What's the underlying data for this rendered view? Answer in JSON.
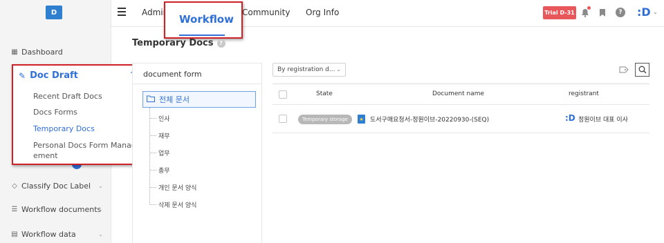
{
  "header": {
    "logo_letter": "D",
    "nav": [
      "Admin",
      "Workflow",
      "Community",
      "Org Info"
    ],
    "trial_badge": "Trial D-31",
    "brand_mark": ":D",
    "highlight_color": "#cf2026",
    "accent_color": "#2f6fd6"
  },
  "sidebar": {
    "dashboard": "Dashboard",
    "doc_draft": {
      "title": "Doc Draft",
      "items": [
        "Recent Draft Docs",
        "Docs Forms",
        "Temporary Docs",
        "Personal Docs Form Manag ement"
      ],
      "active_index": 2
    },
    "classify": "Classify Doc Label",
    "workflow_documents": "Workflow documents",
    "workflow_data": "Workflow data"
  },
  "content": {
    "page_title": "Temporary Docs",
    "tree": {
      "header": "document form",
      "root": "전체 문서",
      "nodes": [
        "인사",
        "재무",
        "업무",
        "총무",
        "개인 문서 양식",
        "삭제 문서 양식"
      ]
    },
    "sort": "By registration d...",
    "table": {
      "columns": [
        "State",
        "Document name",
        "registrant"
      ],
      "rows": [
        {
          "state": "Temporary storage",
          "document_name": "도서구매요청서-정원이브-20220930-(SEQ)",
          "registrant": "정원이브 대표 이사"
        }
      ]
    }
  }
}
